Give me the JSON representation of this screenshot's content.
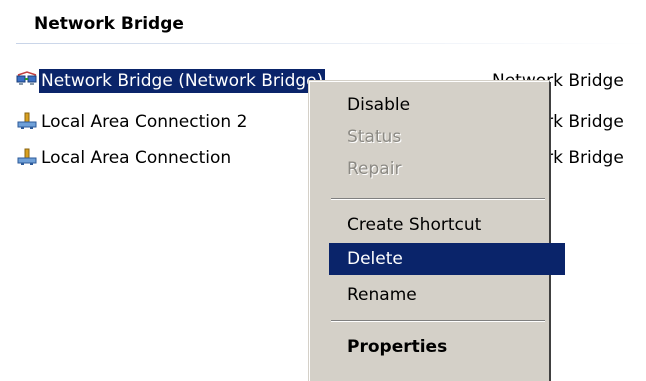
{
  "group": {
    "title": "Network Bridge"
  },
  "connections": [
    {
      "name": "Network Bridge (Network Bridge)",
      "type": "Network Bridge",
      "icon": "bridge-icon",
      "selected": true
    },
    {
      "name": "Local Area Connection 2",
      "type": "Network Bridge",
      "icon": "network-connection-icon"
    },
    {
      "name": "Local Area Connection",
      "type": "Network Bridge",
      "icon": "network-connection-icon"
    }
  ],
  "context_menu": {
    "items": [
      {
        "label": "Disable",
        "enabled": true
      },
      {
        "label": "Status",
        "enabled": false
      },
      {
        "label": "Repair",
        "enabled": false
      },
      {
        "label": "Create Shortcut",
        "enabled": true
      },
      {
        "label": "Delete",
        "enabled": true,
        "highlighted": true
      },
      {
        "label": "Rename",
        "enabled": true
      },
      {
        "label": "Properties",
        "enabled": true,
        "default": true
      }
    ]
  },
  "colors": {
    "selection": "#0a246a",
    "menu_background": "#d4d0c8",
    "disabled_text": "#8c8a84"
  }
}
